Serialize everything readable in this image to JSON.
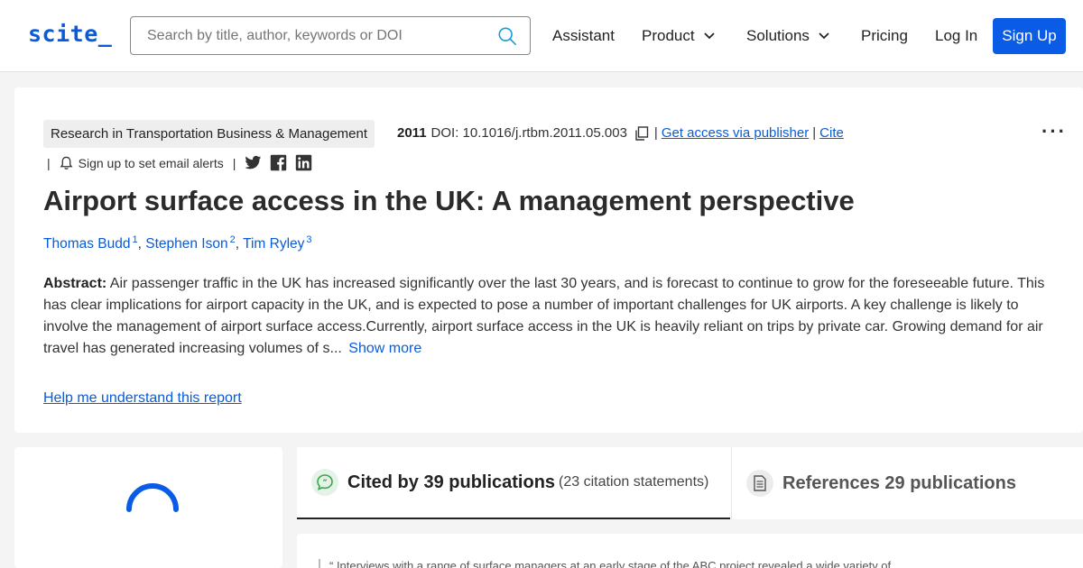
{
  "header": {
    "logo": "scite_",
    "search_placeholder": "Search by title, author, keywords or DOI",
    "nav": {
      "assistant": "Assistant",
      "product": "Product",
      "solutions": "Solutions",
      "pricing": "Pricing",
      "login": "Log In",
      "signup": "Sign Up"
    }
  },
  "paper": {
    "journal": "Research in Transportation Business & Management",
    "year": "2011",
    "doi": "DOI: 10.1016/j.rtbm.2011.05.003",
    "access_link": "Get access via publisher",
    "cite_link": "Cite",
    "alerts_label": "Sign up to set email alerts",
    "title": "Airport surface access in the UK: A management perspective",
    "authors": [
      {
        "name": "Thomas Budd",
        "sup": "1"
      },
      {
        "name": "Stephen Ison",
        "sup": "2"
      },
      {
        "name": "Tim Ryley",
        "sup": "3"
      }
    ],
    "abstract_label": "Abstract:",
    "abstract_text": "Air passenger traffic in the UK has increased significantly over the last 30 years, and is forecast to continue to grow for the foreseeable future. This has clear implications for airport capacity in the UK, and is expected to pose a number of important challenges for UK airports. A key challenge is likely to involve the management of airport surface access.Currently, airport surface access in the UK is heavily reliant on trips by private car. Growing demand for air travel has generated increasing volumes of s...",
    "show_more": "Show more",
    "help_link": "Help me understand this report"
  },
  "tabs": {
    "cited": {
      "title": "Cited by 39 publications",
      "sub": "(23 citation statements)"
    },
    "references": {
      "title": "References 29 publications"
    }
  },
  "statement_snippet": "“ Interviews with a range of surface managers at an early stage of the ABC project revealed a wide variety of",
  "colors": {
    "brand": "#0a5bd8",
    "button": "#0a5ce6",
    "cited_badge": "#3aa64a"
  }
}
